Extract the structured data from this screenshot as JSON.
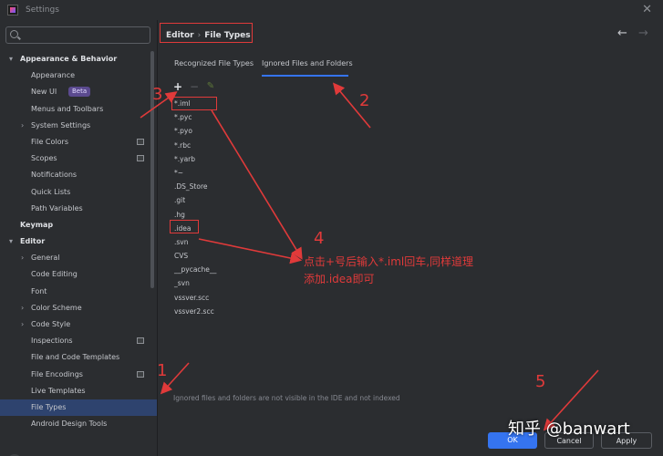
{
  "window": {
    "title": "Settings"
  },
  "search": {
    "placeholder": "",
    "value": ""
  },
  "sidebar": {
    "items": [
      {
        "label": "Appearance & Behavior",
        "level": 0,
        "arrow": "▾",
        "bold": true
      },
      {
        "label": "Appearance",
        "level": 2
      },
      {
        "label": "New UI",
        "level": 2,
        "badge": "Beta"
      },
      {
        "label": "Menus and Toolbars",
        "level": 2
      },
      {
        "label": "System Settings",
        "level": 1,
        "arrow": "›"
      },
      {
        "label": "File Colors",
        "level": 2,
        "icon": true
      },
      {
        "label": "Scopes",
        "level": 2,
        "icon": true
      },
      {
        "label": "Notifications",
        "level": 2
      },
      {
        "label": "Quick Lists",
        "level": 2
      },
      {
        "label": "Path Variables",
        "level": 2
      },
      {
        "label": "Keymap",
        "level": 0,
        "bold": true
      },
      {
        "label": "Editor",
        "level": 0,
        "arrow": "▾",
        "bold": true
      },
      {
        "label": "General",
        "level": 1,
        "arrow": "›"
      },
      {
        "label": "Code Editing",
        "level": 2
      },
      {
        "label": "Font",
        "level": 2
      },
      {
        "label": "Color Scheme",
        "level": 1,
        "arrow": "›"
      },
      {
        "label": "Code Style",
        "level": 1,
        "arrow": "›"
      },
      {
        "label": "Inspections",
        "level": 2,
        "icon": true
      },
      {
        "label": "File and Code Templates",
        "level": 2
      },
      {
        "label": "File Encodings",
        "level": 2,
        "icon": true
      },
      {
        "label": "Live Templates",
        "level": 2
      },
      {
        "label": "File Types",
        "level": 2,
        "selected": true
      },
      {
        "label": "Android Design Tools",
        "level": 2
      }
    ],
    "help_label": "?"
  },
  "breadcrumb": {
    "parent": "Editor",
    "separator": "›",
    "current": "File Types"
  },
  "nav": {
    "back": "←",
    "forward": "→"
  },
  "tabs": [
    {
      "label": "Recognized File Types",
      "active": false
    },
    {
      "label": "Ignored Files and Folders",
      "active": true
    }
  ],
  "toolbar": {
    "add": "+",
    "remove": "−",
    "edit": "✎"
  },
  "ignored_files": [
    "*.iml",
    "*.pyc",
    "*.pyo",
    "*.rbc",
    "*.yarb",
    "*~",
    ".DS_Store",
    ".git",
    ".hg",
    ".idea",
    ".svn",
    "CVS",
    "__pycache__",
    "_svn",
    "vssver.scc",
    "vssver2.scc"
  ],
  "footnote": "Ignored files and folders are not visible in the IDE and not indexed",
  "buttons": {
    "ok": "OK",
    "cancel": "Cancel",
    "apply": "Apply"
  },
  "annotations": {
    "numbers": [
      "1",
      "2",
      "3",
      "4",
      "5"
    ],
    "note_line1": "点击+号后输入*.iml回车,同样道理",
    "note_line2": "添加.idea即可",
    "color": "#e03a3a"
  },
  "watermark": "知乎 @banwart",
  "colors": {
    "background": "#2b2d30",
    "selection": "#2e436e",
    "accent": "#3574f0",
    "annotation": "#e03a3a"
  }
}
